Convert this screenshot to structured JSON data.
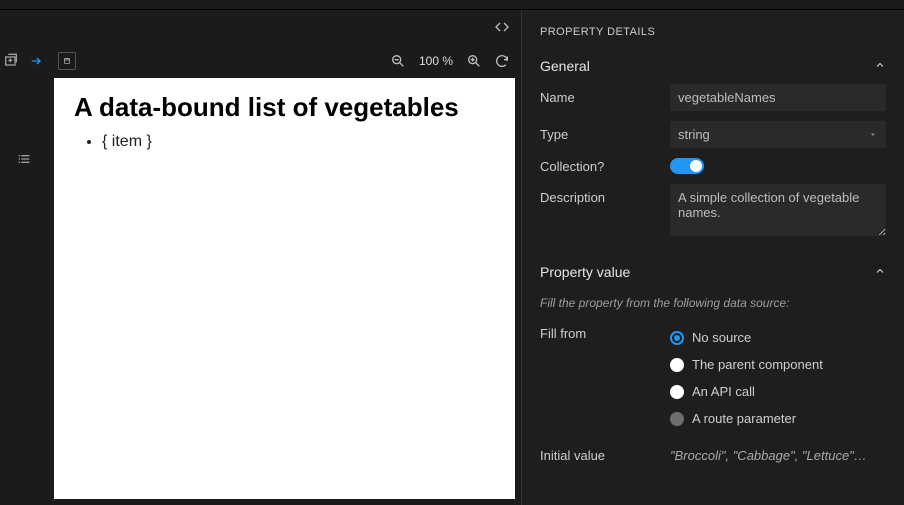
{
  "panel_title": "PROPERTY DETAILS",
  "toolbar": {
    "zoom_label": "100 %"
  },
  "preview": {
    "heading": "A data-bound list of vegetables",
    "item_placeholder": "{ item }"
  },
  "sections": {
    "general": {
      "title": "General",
      "expanded": true
    },
    "property_value": {
      "title": "Property value",
      "expanded": true
    }
  },
  "general": {
    "name_label": "Name",
    "name_value": "vegetableNames",
    "type_label": "Type",
    "type_value": "string",
    "collection_label": "Collection?",
    "collection_on": true,
    "description_label": "Description",
    "description_value": "A simple collection of vegetable names."
  },
  "value": {
    "hint": "Fill the property from the following data source:",
    "fill_from_label": "Fill from",
    "options": [
      {
        "label": "No source",
        "state": "selected"
      },
      {
        "label": "The parent component",
        "state": "filled"
      },
      {
        "label": "An API call",
        "state": "filled"
      },
      {
        "label": "A route parameter",
        "state": "disabled"
      }
    ],
    "initial_label": "Initial value",
    "initial_display": "\"Broccoli\", \"Cabbage\", \"Lettuce\"…"
  }
}
